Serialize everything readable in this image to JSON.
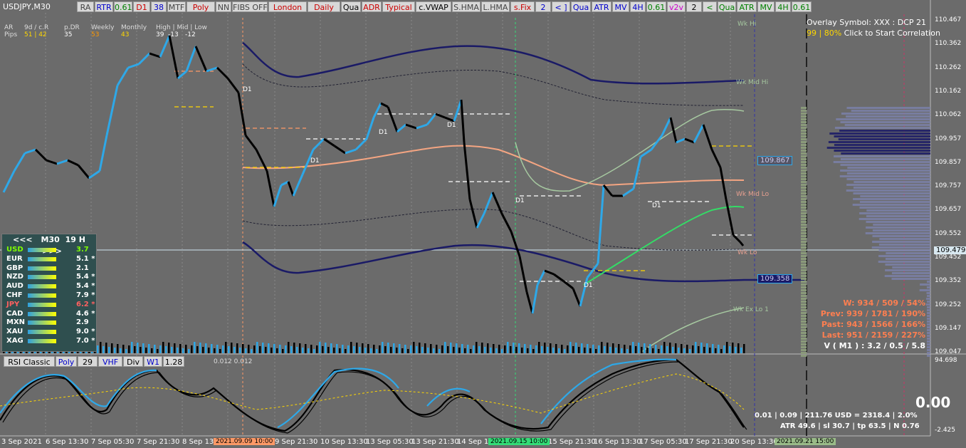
{
  "symbol": "USDJPY,M30",
  "toolbar": [
    {
      "label": "RA",
      "color": "#444"
    },
    {
      "label": "RTR",
      "color": "#0000cc"
    },
    {
      "label": "0.61",
      "color": "#008000"
    },
    {
      "label": "D1",
      "color": "#cc0000"
    },
    {
      "label": "38",
      "color": "#0000cc"
    },
    {
      "label": "MTF",
      "color": "#444"
    },
    {
      "label": "Poly",
      "color": "#cc0000"
    },
    {
      "label": "NN",
      "color": "#444"
    },
    {
      "label": "FIBS OFF",
      "color": "#444"
    },
    {
      "label": "London",
      "color": "#cc0000"
    },
    {
      "label": "Daily",
      "color": "#cc0000"
    },
    {
      "label": "Qua",
      "color": "#000"
    },
    {
      "label": "ADR",
      "color": "#cc0000"
    },
    {
      "label": "Typical",
      "color": "#cc0000"
    },
    {
      "label": "c.VWAP",
      "color": "#000"
    },
    {
      "label": "S.HMA",
      "color": "#444"
    },
    {
      "label": "L.HMA",
      "color": "#444"
    },
    {
      "label": "s.Fix",
      "color": "#cc0000"
    },
    {
      "label": "2",
      "color": "#0000cc"
    },
    {
      "label": "< ]",
      "color": "#0000cc"
    },
    {
      "label": "Qua",
      "color": "#0000cc"
    },
    {
      "label": "ATR",
      "color": "#0000cc"
    },
    {
      "label": "MV",
      "color": "#0000cc"
    },
    {
      "label": "4H",
      "color": "#0000cc"
    },
    {
      "label": "0.61",
      "color": "#008000"
    },
    {
      "label": "v2v",
      "color": "#cc00cc"
    },
    {
      "label": "2",
      "color": "#000"
    },
    {
      "label": "<",
      "color": "#008000"
    },
    {
      "label": "Qua",
      "color": "#008000"
    },
    {
      "label": "ATR",
      "color": "#008000"
    },
    {
      "label": "MV",
      "color": "#008000"
    },
    {
      "label": "4H",
      "color": "#008000"
    },
    {
      "label": "0.61",
      "color": "#008000"
    }
  ],
  "ar": {
    "r1": {
      "a": "AR",
      "b": "9d / c.R",
      "c": "p.DR",
      "d": "Weekly",
      "e": "Monthly",
      "f": "High | Mid | Low"
    },
    "r2": {
      "a": "Pips",
      "b": "51 | 42",
      "c": "35",
      "d": "53",
      "e": "43",
      "f": "39",
      "g": "-13",
      "h": "-12"
    }
  },
  "overlay": {
    "line1": "Overlay Symbol: XXX : DCP 21",
    "line2a": "99 | 80% ",
    "line2b": "Click to Start Correlation"
  },
  "strength": {
    "header": {
      "left": "<<<",
      "tf": "M30",
      "hours": "19",
      "unit": "H",
      "right": ">>>"
    },
    "rows": [
      {
        "c": "USD",
        "v": "3.7",
        "col": "#7fff00"
      },
      {
        "c": "EUR",
        "v": "5.1 *",
        "col": "#ffffff"
      },
      {
        "c": "GBP",
        "v": "2.1",
        "col": "#ffffff"
      },
      {
        "c": "NZD",
        "v": "5.4 *",
        "col": "#ffffff"
      },
      {
        "c": "AUD",
        "v": "5.4 *",
        "col": "#ffffff"
      },
      {
        "c": "CHF",
        "v": "7.9 *",
        "col": "#ffffff"
      },
      {
        "c": "JPY",
        "v": "6.2 *",
        "col": "#ff6060"
      },
      {
        "c": "CAD",
        "v": "4.6 *",
        "col": "#ffffff"
      },
      {
        "c": "MXN",
        "v": "2.9",
        "col": "#ffffff"
      },
      {
        "c": "XAU",
        "v": "9.0 *",
        "col": "#ffffff"
      },
      {
        "c": "XAG",
        "v": "7.0 *",
        "col": "#ffffff"
      }
    ]
  },
  "yticks": [
    "110.467",
    "110.362",
    "110.262",
    "110.162",
    "110.062",
    "109.957",
    "109.857",
    "109.757",
    "109.657",
    "109.552",
    "109.452",
    "109.352",
    "109.252",
    "109.147",
    "109.047"
  ],
  "price_badge": "109.479",
  "level_badges": [
    "109.867",
    "109.358"
  ],
  "level_labels": [
    "Wk Hi",
    "Wk Mid Hi",
    "Wk Mid Lo",
    "Wk Lo",
    "Wk Ex Lo 1",
    "D1",
    "D1",
    "D1",
    "D1",
    "D1",
    "D1",
    "D1"
  ],
  "stats": {
    "w": "W: 934 / 509 / 54%",
    "prev": "Prev: 939 / 1781 / 190%",
    "past": "Past: 943 / 1566 / 166%",
    "last": "Last: 951 / 2159 / 227%",
    "v": "V ( M1 ) : 3.2 / 0.5 / 5.8"
  },
  "rsi": {
    "labels": [
      "RSI Classic",
      "Poly",
      "29",
      "VHF",
      "Div",
      "W1",
      "1.28"
    ],
    "value_text": "0.012 0.012",
    "top": "94.698",
    "bottom": "-2.425",
    "big": "0.00",
    "line1": "0.01  |  0.09  |  211.76 USD = 2318.4  |  2.0%",
    "line2": "ATR 49.6  |  sl 30.7  |  tp 63.5  |  N 0.76"
  },
  "xticks": [
    "3 Sep 2021",
    "6 Sep 13:30",
    "7 Sep 05:30",
    "7 Sep 21:30",
    "8 Sep 13:30",
    "9 Sep 21:30",
    "10 Sep 13:30",
    "13 Sep 05:30",
    "13 Sep 21:30",
    "14 Sep 13:30",
    "15 Sep 21:30",
    "16 Sep 13:30",
    "17 Sep 05:30",
    "17 Sep 21:30",
    "20 Sep 13:30"
  ],
  "xbadges": [
    {
      "t": "2021.09.09 10:00",
      "bg": "#ff9966"
    },
    {
      "t": "2021.09.15 10:00",
      "bg": "#33dd77"
    },
    {
      "t": "2021.09.21 15:00",
      "bg": "#99bb88"
    }
  ],
  "colors": {
    "bg": "#6b6b6b",
    "bull": "#2ea8e8",
    "bear": "#000000",
    "navy": "#1a1a66",
    "salmon": "#f4a582",
    "green": "#33dd66",
    "pale": "#a6c8a0"
  }
}
